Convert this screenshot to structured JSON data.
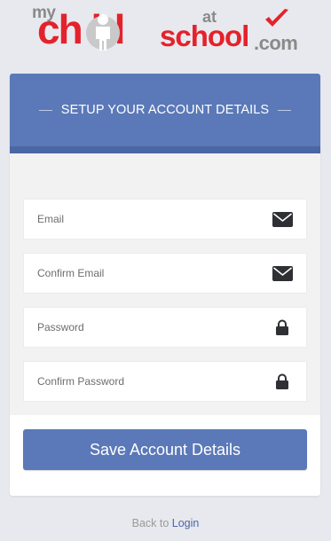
{
  "logo": {
    "my": "my",
    "child": "ch  ld",
    "at": "at",
    "school": "school",
    "com": ".com",
    "brand_red": "#e4222b",
    "brand_grey": "#8a8a8a"
  },
  "card": {
    "title": "SETUP YOUR ACCOUNT DETAILS",
    "header_color": "#5b79b8"
  },
  "fields": {
    "email": {
      "placeholder": "Email",
      "value": "",
      "icon": "envelope-icon"
    },
    "confirm_email": {
      "placeholder": "Confirm Email",
      "value": "",
      "icon": "envelope-icon"
    },
    "password": {
      "placeholder": "Password",
      "value": "",
      "icon": "lock-icon"
    },
    "confirm_password": {
      "placeholder": "Confirm Password",
      "value": "",
      "icon": "lock-icon"
    }
  },
  "save_button": {
    "label": "Save Account Details"
  },
  "footer": {
    "back_text": "Back to",
    "login_link": "Login"
  }
}
